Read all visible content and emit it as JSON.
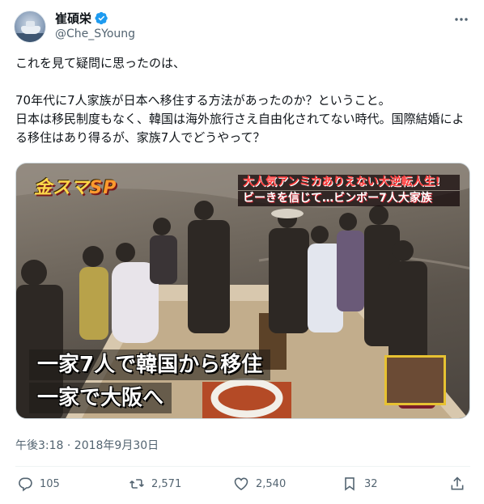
{
  "author": {
    "display_name": "崔碩栄",
    "handle": "@Che_SYoung",
    "avatar_icon": "boat-avatar",
    "verified_icon": "verified-badge-icon"
  },
  "tweet": {
    "text": "これを見て疑問に思ったのは、\n\n70年代に7人家族が日本へ移住する方法があったのか？ということ。\n日本は移民制度もなく、韓国は海外旅行さえ自由化されてない時代。国際結婚による移住はあり得るが、家族7人でどうやって？"
  },
  "media": {
    "logo_main": "金スマ",
    "logo_sp": "SP",
    "banner_top": "大人気アンミカありえない大逆転人生!",
    "banner_bottom": "ビーきを信じて…ビンボー7人大家族",
    "caption_line1": "一家7人で韓国から移住",
    "caption_line2": "一家で大阪へ"
  },
  "timestamp": "午後3:18 · 2018年9月30日",
  "actions": {
    "replies": "105",
    "retweets": "2,571",
    "likes": "2,540",
    "bookmarks": "32"
  },
  "colors": {
    "text_primary": "#0f1419",
    "text_secondary": "#536471",
    "verified_blue": "#1d9bf0",
    "divider": "#eff3f4"
  }
}
